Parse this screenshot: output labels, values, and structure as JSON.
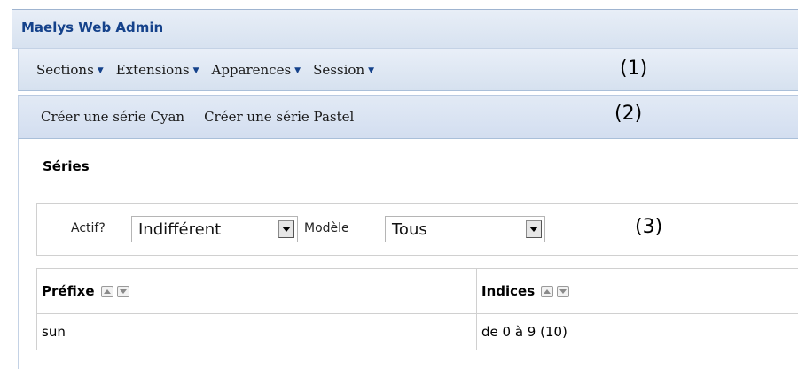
{
  "window": {
    "title": "Maelys Web Admin"
  },
  "menubar": {
    "items": [
      {
        "label": "Sections"
      },
      {
        "label": "Extensions"
      },
      {
        "label": "Apparences"
      },
      {
        "label": "Session"
      }
    ],
    "arrow_glyph": "▼",
    "callout": "(1)"
  },
  "subbar": {
    "links": [
      {
        "label": "Créer une série Cyan"
      },
      {
        "label": "Créer une série Pastel"
      }
    ],
    "callout": "(2)"
  },
  "main": {
    "section_title": "Séries",
    "filters": {
      "active_label": "Actif?",
      "active_value": "Indifférent",
      "model_label": "Modèle",
      "model_value": "Tous",
      "callout": "(3)"
    },
    "table": {
      "columns": [
        {
          "label": "Préfixe"
        },
        {
          "label": "Indices"
        }
      ],
      "rows": [
        {
          "prefix": "sun",
          "indices": "de 0 à 9 (10)"
        }
      ]
    }
  },
  "colors": {
    "accent": "#15428b",
    "bar_bg": "#d7e2f0",
    "border": "#d0d0d0"
  },
  "icons": {
    "menu_arrow": "chevron-down-icon",
    "sort_up": "sort-up-icon",
    "sort_down": "sort-down-icon",
    "select_dropdown": "dropdown-arrow-icon"
  }
}
